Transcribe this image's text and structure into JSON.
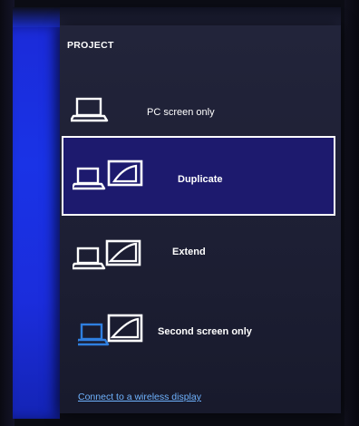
{
  "panel": {
    "title": "PROJECT",
    "options": [
      {
        "label": "PC screen only",
        "icon": "laptop-icon",
        "selected": false
      },
      {
        "label": "Duplicate",
        "icon": "laptop-and-monitor-icon",
        "selected": true
      },
      {
        "label": "Extend",
        "icon": "laptop-extend-monitor-icon",
        "selected": false
      },
      {
        "label": "Second screen only",
        "icon": "monitor-only-icon",
        "selected": false
      }
    ],
    "wireless_link": "Connect to a wireless display"
  },
  "colors": {
    "desktop_blue": "#1a33e6",
    "panel_bg": "#1f2136",
    "selected_bg": "#1d1a6e",
    "link": "#6fb3ff",
    "disabled_laptop": "#2f7fe0"
  }
}
